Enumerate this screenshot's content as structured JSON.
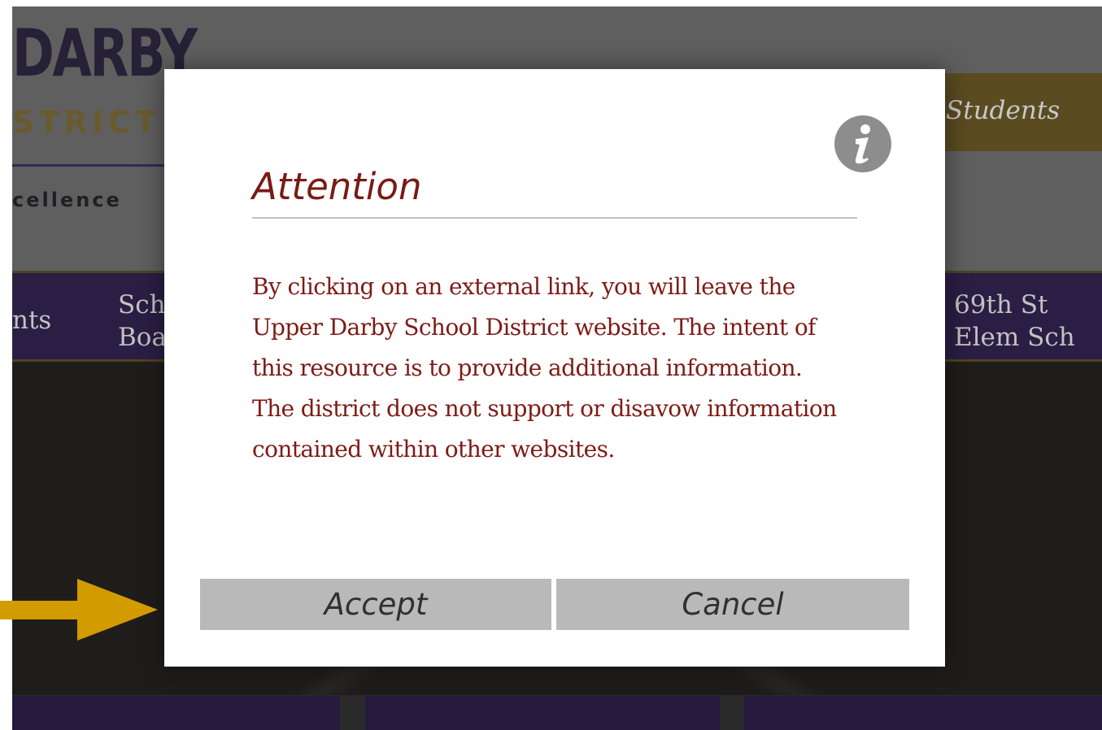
{
  "site": {
    "logo_top": "DARBY",
    "logo_bottom": "STRICT",
    "tagline": "cellence",
    "students_tab": "Students",
    "nav": [
      {
        "line1": "nts",
        "line2": ""
      },
      {
        "line1": "Sch",
        "line2": "Boa"
      },
      {
        "line1": "69th St",
        "line2": "Elem Sch"
      }
    ]
  },
  "dialog": {
    "icon": "info-icon",
    "title": "Attention",
    "message": "By clicking on an external link, you will leave the Upper Darby School District website. The intent of this resource is to provide additional information. The district does not support or disavow information contained within other websites.",
    "accept_label": "Accept",
    "cancel_label": "Cancel"
  },
  "annotation": {
    "arrow_color": "#d29b00",
    "points_to": "Accept"
  },
  "colors": {
    "dialog_text": "#7e1b16",
    "button_bg": "#b9b9b9",
    "nav_bg": "#2a1e44",
    "accent_gold": "#5b4b21"
  }
}
